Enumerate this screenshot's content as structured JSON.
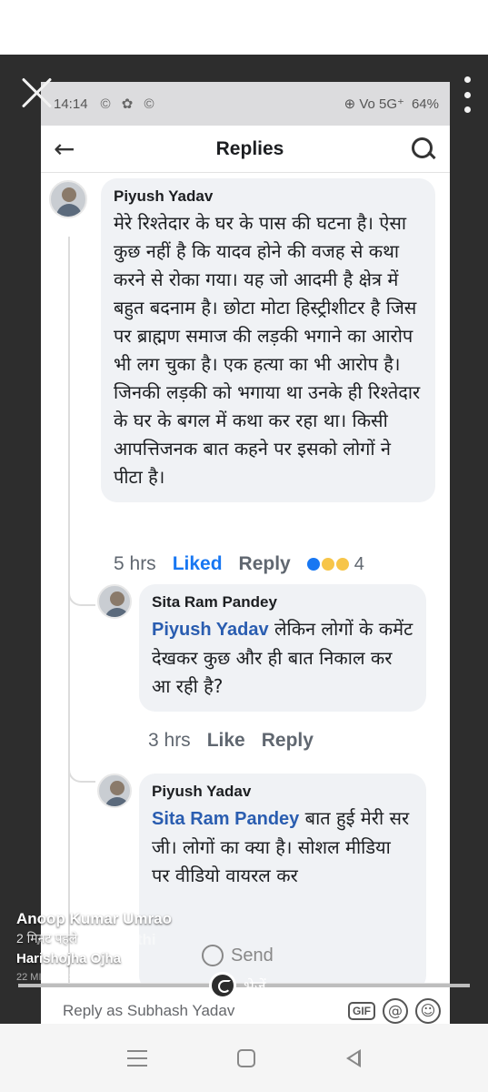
{
  "status_bar": {
    "time": "14:14",
    "app_icons": "© ✿ ©",
    "network": "⊕ Vo 5G⁺",
    "battery": "64%"
  },
  "app_bar": {
    "title": "Replies"
  },
  "comments": [
    {
      "name": "Piyush Yadav",
      "text": "मेरे रिश्तेदार के घर के पास की घटना है। ऐसा कुछ नहीं है कि यादव होने की वजह से कथा करने से रोका गया। यह जो आदमी है क्षेत्र में बहुत बदनाम है। छोटा मोटा हिस्ट्रीशीटर है जिस पर ब्राह्मण समाज की लड़की भगाने का आरोप भी लग चुका है। एक हत्या का भी आरोप है। जिनकी लड़की को भगाया था उनके ही रिश्तेदार के घर के बगल में कथा कर रहा था। किसी आपत्तिजनक बात कहने पर इसको लोगों ने पीटा है।",
      "time": "5 hrs",
      "like_label": "Liked",
      "reply_label": "Reply",
      "reaction_count": "4"
    },
    {
      "name": "Sita Ram Pandey",
      "mention": "Piyush Yadav",
      "text": "लेकिन लोगों के कमेंट देखकर कुछ और ही बात निकाल कर आ रही है?",
      "time": "3 hrs",
      "like_label": "Like",
      "reply_label": "Reply"
    },
    {
      "name": "Piyush Yadav",
      "mention": "Sita Ram Pandey",
      "text": "बात हुई मेरी सर जी। लोगों का क्या है। सोशल मीडिया पर वीडियो वायरल कर"
    }
  ],
  "reply_box": {
    "placeholder": "Reply as Subhash Yadav",
    "gif": "GIF",
    "at": "@",
    "emoji": "☺"
  },
  "overlay": {
    "ghost_name": "Avinash Tripathi",
    "poster_name": "Anoop Kumar Umrao",
    "poster_time": "2 मिनट पहले",
    "sender_name": "Harishojha Ojha",
    "sender_time": "22 MINUTES AGO",
    "send_label": "Send",
    "share_label": "भेजें"
  }
}
